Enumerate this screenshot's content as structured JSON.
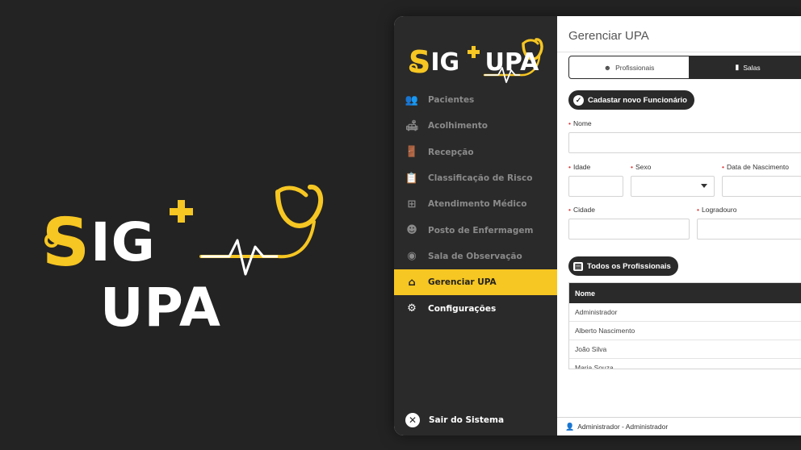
{
  "brand": {
    "name_prefix": "S",
    "name_rest": "IG ",
    "name_suffix": "UPA",
    "accent": "#f6c622",
    "dark": "#2a2a2a",
    "background": "#232323"
  },
  "sidebar": {
    "items": [
      {
        "label": "Pacientes",
        "icon": "users-icon",
        "glyph": "👥"
      },
      {
        "label": "Acolhimento",
        "icon": "sofa-icon",
        "glyph": "🛋"
      },
      {
        "label": "Recepção",
        "icon": "door-icon",
        "glyph": "🚪"
      },
      {
        "label": "Classificação de Risco",
        "icon": "clipboard-icon",
        "glyph": "📋"
      },
      {
        "label": "Atendimento Médico",
        "icon": "medical-kit-icon",
        "glyph": "⊞"
      },
      {
        "label": "Posto de Enfermagem",
        "icon": "nurse-icon",
        "glyph": "☻"
      },
      {
        "label": "Sala de Observação",
        "icon": "eye-icon",
        "glyph": "◉"
      },
      {
        "label": "Gerenciar UPA",
        "icon": "hospital-icon",
        "glyph": "⌂"
      },
      {
        "label": "Configurações",
        "icon": "gear-icon",
        "glyph": "⚙"
      }
    ],
    "logout": {
      "label": "Sair do Sistema",
      "icon": "close-circle-icon",
      "glyph": "✕"
    }
  },
  "main": {
    "title": "Gerenciar UPA",
    "tabs": [
      {
        "label": "Profissionais",
        "icon": "nurse-icon",
        "glyph": "☻"
      },
      {
        "label": "Salas",
        "icon": "door-icon",
        "glyph": "▮"
      }
    ],
    "register_button": {
      "label": "Cadastar novo Funcionário",
      "glyph": "✓"
    },
    "form": {
      "nome": "Nome",
      "idade": "Idade",
      "sexo": "Sexo",
      "nascimento": "Data de Nascimento",
      "cidade": "Cidade",
      "logradouro": "Logradouro"
    },
    "list_button": {
      "label": "Todos os Profissionais",
      "glyph": "▤"
    },
    "table": {
      "header": "Nome",
      "rows": [
        "Administrador",
        "Alberto Nascimento",
        "João Silva",
        "Maria Souza"
      ]
    },
    "footer": {
      "user": "Administrador - Administrador",
      "glyph": "👤"
    }
  }
}
